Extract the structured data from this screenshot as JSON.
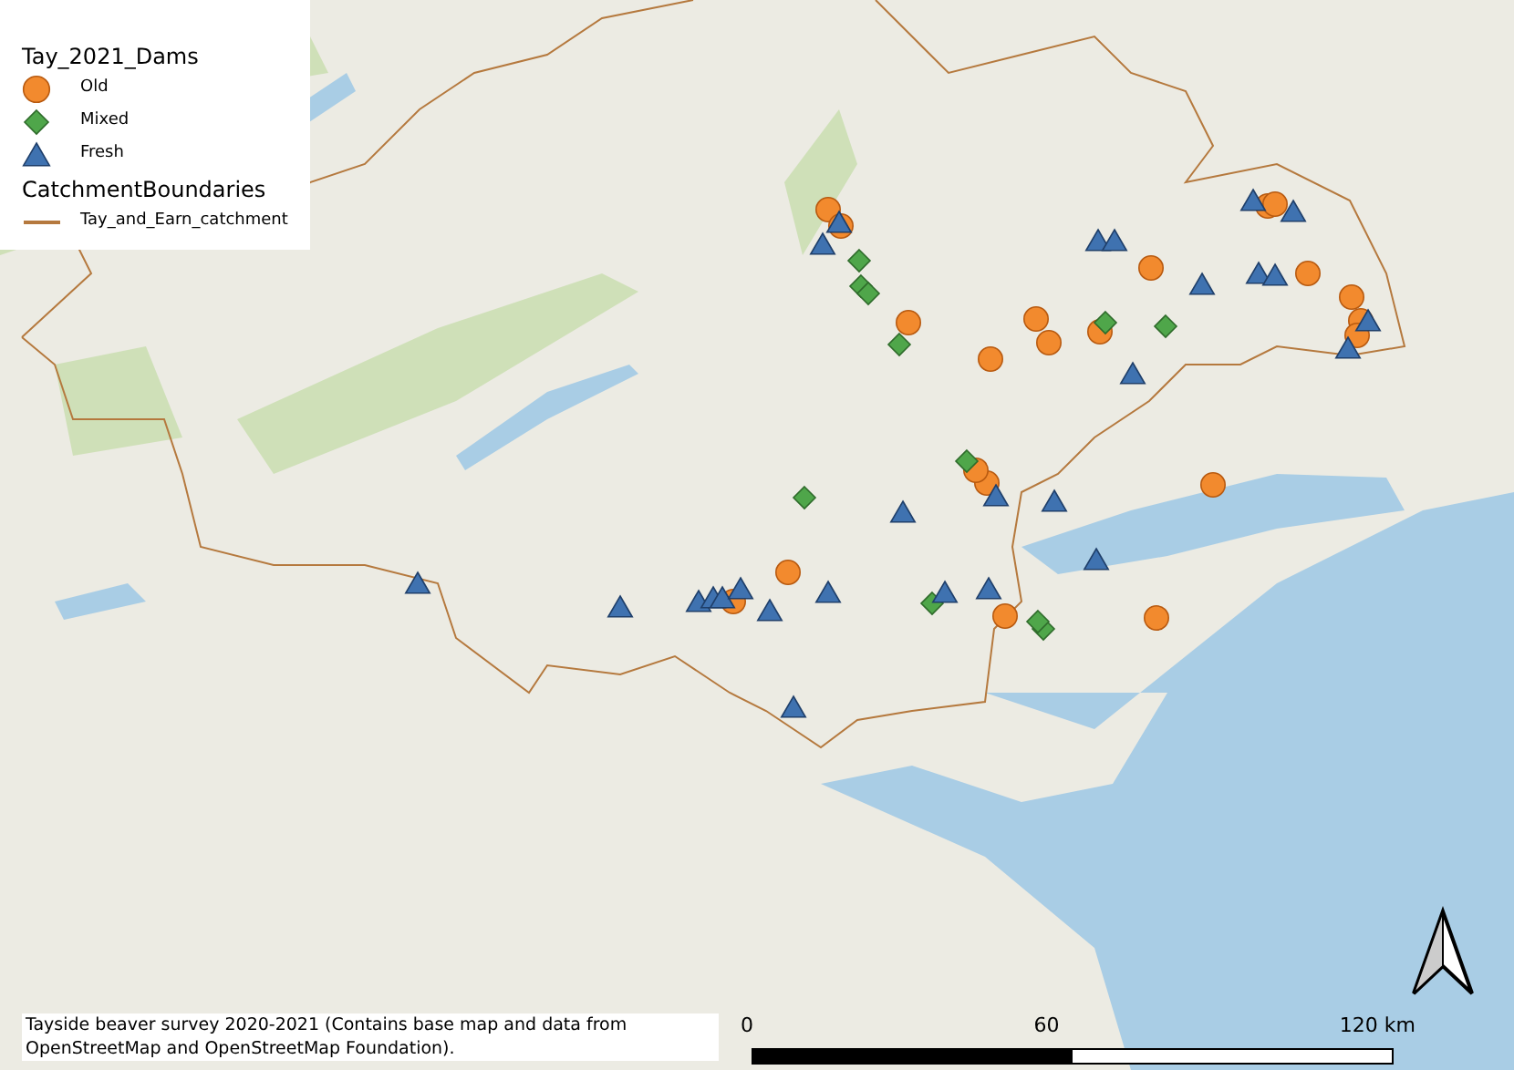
{
  "legend": {
    "groups": [
      {
        "title": "Tay_2021_Dams",
        "items": [
          {
            "label": "Old",
            "kind": "circle",
            "color": "#f28a2e"
          },
          {
            "label": "Mixed",
            "kind": "diamond",
            "color": "#4fa64a"
          },
          {
            "label": "Fresh",
            "kind": "triangle",
            "color": "#3f72b0"
          }
        ]
      },
      {
        "title": "CatchmentBoundaries",
        "items": [
          {
            "label": "Tay_and_Earn_catchment",
            "kind": "line",
            "color": "#b5793e"
          }
        ]
      }
    ]
  },
  "credit": "Tayside beaver survey 2020-2021 (Contains base map and data from OpenStreetMap and OpenStreetMap Foundation).",
  "scale_bar": {
    "labels": [
      "0",
      "60",
      "120 km"
    ]
  }
}
